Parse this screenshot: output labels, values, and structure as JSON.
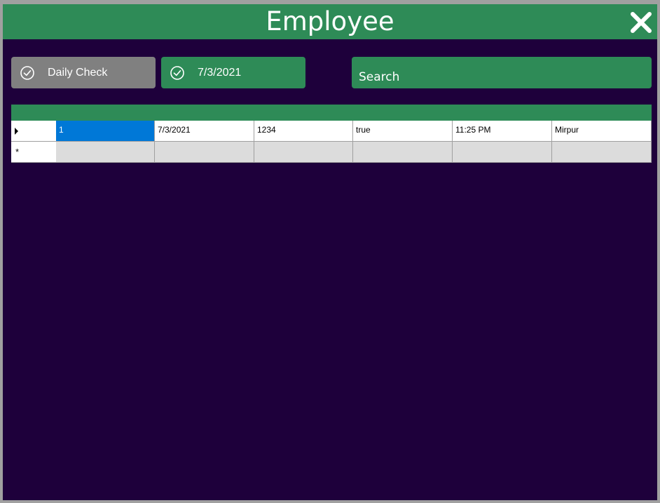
{
  "window": {
    "title": "Employee",
    "colors": {
      "titlebar": "#2e8b57",
      "background": "#1e003b",
      "accent": "#2e8b57",
      "inactive_button": "#808080",
      "selection": "#0078d7"
    }
  },
  "toolbar": {
    "daily_check_label": "Daily Check",
    "date_label": "7/3/2021",
    "search_placeholder": "Search"
  },
  "grid": {
    "rows": [
      {
        "cells": [
          "1",
          "7/3/2021",
          "1234",
          "true",
          "11:25 PM",
          "Mirpur"
        ]
      }
    ],
    "new_row_marker": "*"
  }
}
